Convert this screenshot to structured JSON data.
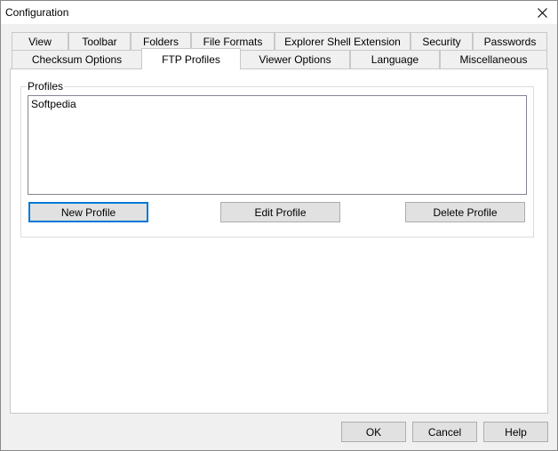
{
  "window": {
    "title": "Configuration"
  },
  "tabs": {
    "row_back": [
      "View",
      "Toolbar",
      "Folders",
      "File Formats",
      "Explorer Shell Extension",
      "Security",
      "Passwords"
    ],
    "row_front": [
      "Checksum Options",
      "FTP Profiles",
      "Viewer Options",
      "Language",
      "Miscellaneous"
    ],
    "selected": "FTP Profiles"
  },
  "profiles": {
    "group_label": "Profiles",
    "items": [
      "Softpedia"
    ],
    "new_label": "New Profile",
    "edit_label": "Edit Profile",
    "delete_label": "Delete Profile"
  },
  "footer": {
    "ok_label": "OK",
    "cancel_label": "Cancel",
    "help_label": "Help"
  },
  "colors": {
    "accent": "#0078d7",
    "window_bg": "#f0f0f0",
    "panel_bg": "#ffffff"
  }
}
